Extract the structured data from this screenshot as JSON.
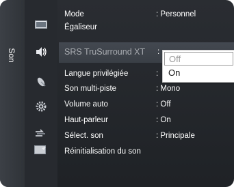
{
  "menu": {
    "section_label": "Son",
    "items": [
      {
        "label": "Mode",
        "value": ": Personnel"
      },
      {
        "label": "Égaliseur",
        "value": ""
      },
      {
        "label": "SRS TruSurround XT",
        "value": ":"
      },
      {
        "label": "Langue privilégiée",
        "value": ":"
      },
      {
        "label": "Son multi-piste",
        "value": ": Mono"
      },
      {
        "label": "Volume auto",
        "value": ": Off"
      },
      {
        "label": "Haut-parleur",
        "value": ": On"
      },
      {
        "label": "Sélect. son",
        "value": ": Principale"
      },
      {
        "label": "Réinitialisation du son",
        "value": ""
      }
    ]
  },
  "dropdown": {
    "options": [
      "Off",
      "On"
    ],
    "highlighted": "Off"
  },
  "icons": [
    "picture-icon",
    "sound-icon",
    "satellite-dish-icon",
    "gear-icon",
    "input-icon",
    "media-icon"
  ],
  "colors": {
    "panel": "#25282d",
    "highlight_row": "#3e434a",
    "text": "#ffffff",
    "dim_text": "#8d9097"
  }
}
